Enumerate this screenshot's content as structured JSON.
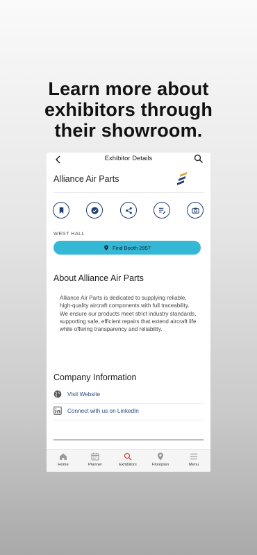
{
  "headline": [
    "Learn more about",
    "exhibitors through",
    "their showroom."
  ],
  "header": {
    "title": "Exhibitor Details"
  },
  "exhibitor": {
    "name": "Alliance Air Parts",
    "hall": "WEST HALL",
    "find_booth_label": "Find Booth 2957"
  },
  "about": {
    "title": "About Alliance Air Parts",
    "text": "Alliance Air Parts is dedicated to supplying reliable, high-quality aircraft components with full traceability. We ensure our products meet strict industry standards, supporting safe, efficient repairs that extend aircraft life while offering transparency and reliability."
  },
  "company_info": {
    "title": "Company Information",
    "website_label": "Visit Website",
    "linkedin_label": "Connect with us on LinkedIn"
  },
  "tabs": [
    {
      "label": "Home",
      "icon": "home-icon"
    },
    {
      "label": "Planner",
      "icon": "calendar-icon"
    },
    {
      "label": "Exhibitors",
      "icon": "search-icon",
      "active": true
    },
    {
      "label": "Floorplan",
      "icon": "map-pin-icon"
    },
    {
      "label": "Menu",
      "icon": "hamburger-icon"
    }
  ],
  "colors": {
    "accent": "#35b7d6",
    "navy": "#1c3d6e",
    "active_tab_icon": "#e0442c",
    "logo_gold": "#d4a744"
  }
}
